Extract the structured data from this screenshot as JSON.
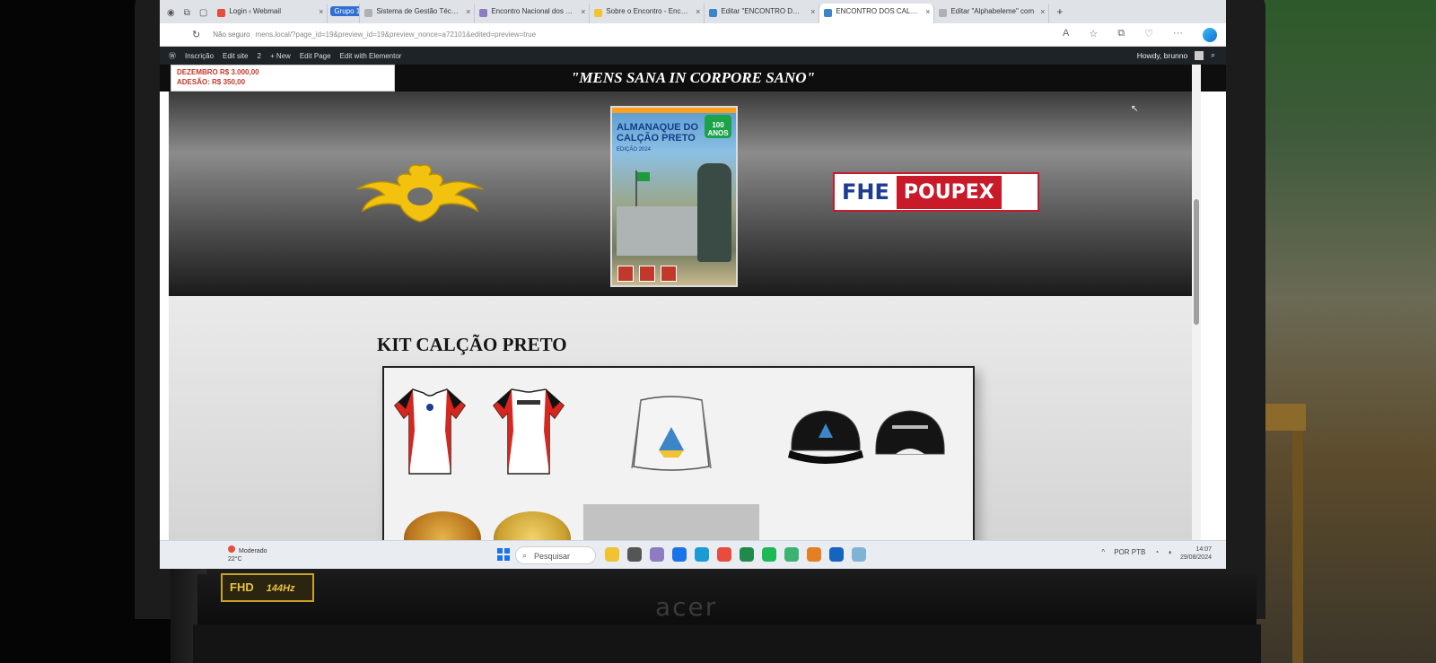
{
  "browser": {
    "tabs": [
      {
        "label": "Login ‹ Webmail"
      },
      {
        "label": "Grupo 1",
        "group": true
      },
      {
        "label": "Sistema de Gestão Técnica"
      },
      {
        "label": "Encontro Nacional dos Calç"
      },
      {
        "label": "Sobre o Encontro - Encontro"
      },
      {
        "label": "Editar \"ENCONTRO DOS CA"
      },
      {
        "label": "ENCONTRO DOS CALÇÕES",
        "active": true
      },
      {
        "label": "Editar \"Alphabeleme\" com"
      }
    ],
    "security_label": "Não seguro",
    "url": "mens.local/?page_id=19&preview_id=19&preview_nonce=a72101&edited=preview=true"
  },
  "wp_admin": {
    "items": [
      "Inscrição",
      "Edit site",
      "2",
      "+ New",
      "Edit Page",
      "Edit with Elementor"
    ],
    "howdy": "Howdy, brunno"
  },
  "site": {
    "info_line1": "DEZEMBRO R$ 3.000,00",
    "info_line2": "ADESÃO: R$ 350,00",
    "motto": "\"MENS SANA IN CORPORE SANO\"",
    "almanaque_title": "ALMANAQUE DO CALÇÃO PRETO",
    "almanaque_badge": "100 ANOS",
    "almanaque_edition": "EDIÇÃO 2024",
    "partner_left": "FHE",
    "partner_right": "POUPEX",
    "kit_title": "KIT CALÇÃO PRETO"
  },
  "taskbar": {
    "weather_temp": "Moderado",
    "weather_desc": "22°C",
    "search_placeholder": "Pesquisar",
    "tray_lang": "POR PTB",
    "time": "14:07",
    "date": "29/08/2024"
  },
  "hardware": {
    "brand": "acer",
    "sticker_model": "FHD",
    "sticker_text": "144Hz"
  },
  "colors": {
    "brand_blue": "#1d3c92",
    "brand_red": "#c91a2a",
    "wp_bar": "#1d2327",
    "shirt_red": "#d7261e",
    "emblem_gold": "#f2c20f"
  }
}
